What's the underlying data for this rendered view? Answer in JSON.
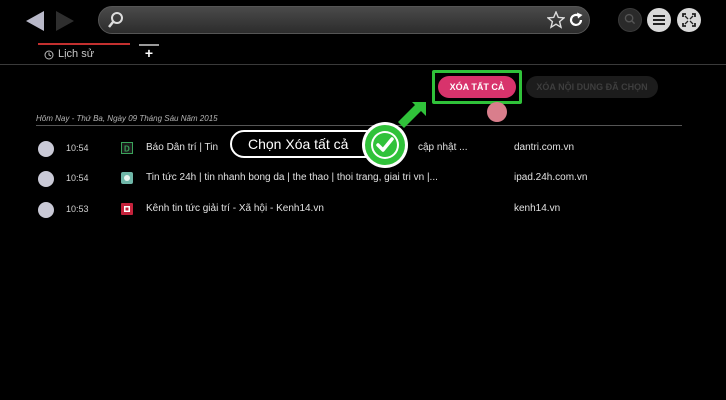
{
  "toolbar": {
    "back_icon": "back-arrow-icon",
    "forward_icon": "forward-arrow-icon",
    "search_icon": "search-icon",
    "star_icon": "star-icon",
    "reload_icon": "reload-icon",
    "zoom_icon": "zoom-icon",
    "menu_icon": "menu-icon",
    "fullscreen_icon": "fullscreen-icon",
    "url_value": ""
  },
  "tabs": [
    {
      "label": "Lịch sử",
      "icon": "clock-icon",
      "active": true
    }
  ],
  "new_tab_label": "+",
  "actions": {
    "delete_all_label": "XÓA TẤT CẢ",
    "delete_selected_label": "XÓA NỘI DUNG ĐÃ CHỌN"
  },
  "history": {
    "date_header": "Hôm Nay - Thứ Ba, Ngày 09 Tháng Sáu Năm 2015",
    "rows": [
      {
        "time": "10:54",
        "title": "Báo Dân trí | Tin",
        "title_tail": "cập nhật ...",
        "domain": "dantri.com.vn",
        "favicon": "dantri-favicon-icon"
      },
      {
        "time": "10:54",
        "title": "Tin tức 24h | tin nhanh bong da | the thao | thoi trang, giai tri vn |...",
        "title_tail": "",
        "domain": "ipad.24h.com.vn",
        "favicon": "24h-favicon-icon"
      },
      {
        "time": "10:53",
        "title": "Kênh tin tức giải trí - Xã hội - Kenh14.vn",
        "title_tail": "",
        "domain": "kenh14.vn",
        "favicon": "kenh14-favicon-icon"
      }
    ]
  },
  "annotation": {
    "tooltip_text": "Chọn Xóa tất cả",
    "highlight_color": "#30c23a",
    "accent_color": "#d8336c"
  }
}
